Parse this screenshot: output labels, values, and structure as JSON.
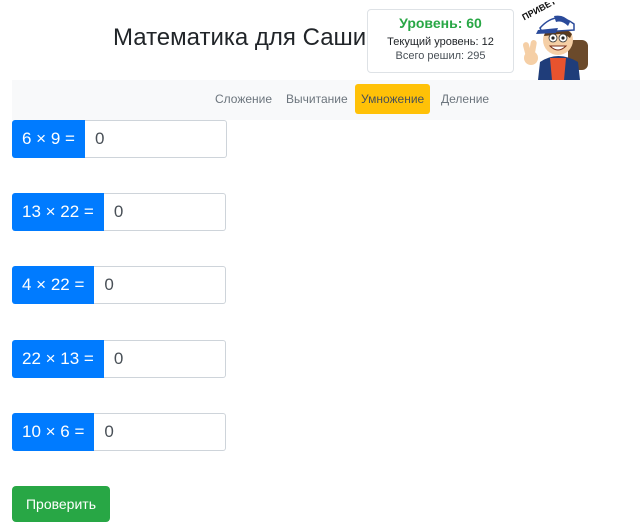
{
  "header": {
    "title": "Математика для Саши"
  },
  "level": {
    "main": "Уровень: 60",
    "current": "Текущий уровень: 12",
    "total": "Всего решил: 295"
  },
  "mascot": {
    "caption": "ПРИВЕТ"
  },
  "nav": {
    "items": [
      {
        "label": "Сложение"
      },
      {
        "label": "Вычитание"
      },
      {
        "label": "Умножение",
        "active": true
      },
      {
        "label": "Деление"
      }
    ]
  },
  "problems": [
    {
      "expression": "6 × 9 =",
      "value": "0"
    },
    {
      "expression": "13 × 22 =",
      "value": "0"
    },
    {
      "expression": "4 × 22 =",
      "value": "0"
    },
    {
      "expression": "22 × 13 =",
      "value": "0"
    },
    {
      "expression": "10 × 6 =",
      "value": "0"
    }
  ],
  "actions": {
    "check_label": "Проверить"
  },
  "colors": {
    "primary": "#007bff",
    "success": "#28a745",
    "warning": "#ffc107"
  }
}
